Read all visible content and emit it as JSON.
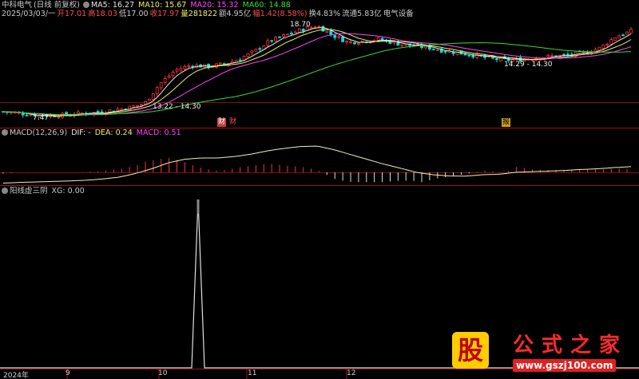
{
  "header": {
    "stock_name": "中科电气",
    "period": "(日线 前复权)",
    "date_line": "2025/03/03/一",
    "ma": [
      {
        "label": "MA5: 16.27",
        "color": "#e8e8e8"
      },
      {
        "label": "MA10: 15.67",
        "color": "#f0f060"
      },
      {
        "label": "MA20: 15.32",
        "color": "#ff44ff"
      },
      {
        "label": "MA60: 14.88",
        "color": "#33dd33"
      }
    ],
    "open": "开17.01",
    "high": "高18.03",
    "low": "低17.00",
    "close": "收17.97",
    "volume": "量281822",
    "amount": "额4.95亿",
    "change": "幅1.42(8.58%)",
    "turnover": "换4.83%",
    "float": "流通5.83亿",
    "industry": "电气设备"
  },
  "macd_panel": {
    "title": "MACD(12,26,9)",
    "dif": "DIF: -",
    "dea": "DEA: 0.24",
    "macd": "MACD: 0.51"
  },
  "indicator_panel": {
    "title": "阳线虚三阴",
    "xg": "XG: 0.00"
  },
  "tags": {
    "cai": "财",
    "bao": "报"
  },
  "logo": {
    "chars": [
      "公",
      "式",
      "之",
      "家"
    ],
    "badge": "股",
    "url": "www.gszj100.com"
  },
  "chart_data": [
    {
      "type": "candlestick",
      "annotations": [
        "18.70",
        "7.47",
        "13.22 - 14.30",
        "14.29 - 14.30"
      ],
      "series": [
        {
          "name": "MA5",
          "color": "#e8e8e8"
        },
        {
          "name": "MA10",
          "color": "#f0f060"
        },
        {
          "name": "MA20",
          "color": "#ff44ff"
        },
        {
          "name": "MA60",
          "color": "#33dd33"
        }
      ],
      "close_path": [
        8.0,
        7.8,
        7.6,
        7.5,
        7.6,
        7.8,
        7.9,
        8.2,
        8.5,
        9.0,
        11.5,
        13.2,
        13.8,
        13.6,
        13.9,
        14.5,
        15.5,
        16.8,
        17.5,
        18.2,
        18.7,
        17.5,
        16.6,
        16.8,
        17.0,
        16.5,
        16.2,
        16.0,
        15.6,
        15.3,
        15.0,
        14.6,
        14.4,
        14.5,
        14.7,
        14.9,
        15.0,
        15.3,
        15.9,
        17.3,
        18.0
      ]
    },
    {
      "type": "line",
      "name": "MACD",
      "dif": [
        -0.45,
        -0.42,
        -0.4,
        -0.38,
        -0.36,
        -0.33,
        -0.28,
        -0.2,
        -0.05,
        0.15,
        0.4,
        0.55,
        0.6,
        0.6,
        0.66,
        0.76,
        0.9,
        1.0,
        1.08,
        1.1,
        0.95,
        0.75,
        0.55,
        0.35,
        0.18,
        0.0,
        -0.1,
        -0.15,
        -0.16,
        -0.1,
        -0.08,
        0.0,
        0.03,
        0.05,
        0.08,
        0.12,
        0.15,
        0.2,
        0.24
      ]
    },
    {
      "type": "line",
      "name": "XG",
      "x_labels": [
        "2024年",
        "9",
        "10",
        "11",
        "12"
      ],
      "peak_index": 0.31,
      "peak_value": 1,
      "baseline": 0
    }
  ]
}
